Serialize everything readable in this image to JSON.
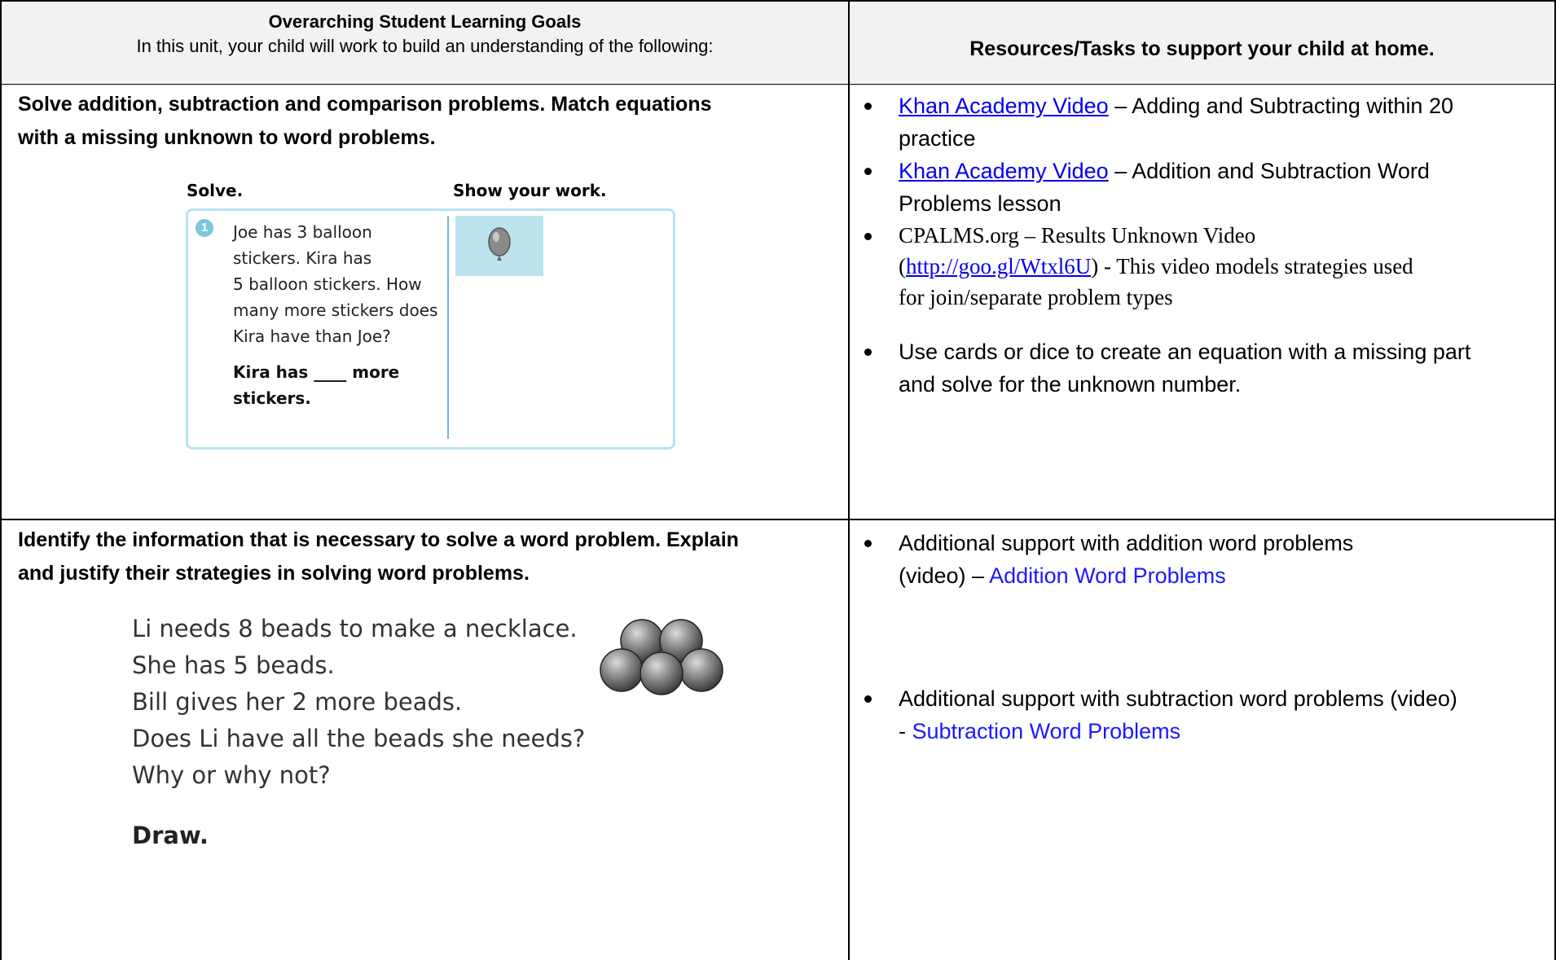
{
  "header": {
    "left_title": "Overarching Student Learning Goals",
    "left_subtitle": "In this unit, your child will work to build an understanding of the following:",
    "right_title": "Resources/Tasks to support your child at home."
  },
  "rows": [
    {
      "goal_line1": "Solve addition, subtraction and comparison problems. Match equations",
      "goal_line2": "with a missing unknown to word problems.",
      "worksheet": {
        "solve_label": "Solve.",
        "show_label": "Show your work.",
        "number": "1",
        "problem_lines": [
          "Joe has 3 balloon",
          "stickers. Kira has",
          "5 balloon stickers. How",
          "many more stickers does",
          "Kira have than Joe?"
        ],
        "answer_line1": "Kira has ____ more",
        "answer_line2": "stickers."
      },
      "resources": [
        {
          "link": "Khan Academy Video",
          "rest1": " – Adding and Subtracting within 20",
          "rest2": "practice"
        },
        {
          "link": "Khan Academy Video",
          "rest1": " – Addition and Subtraction Word",
          "rest2": "Problems lesson"
        },
        {
          "line1": "CPALMS.org – Results Unknown Video",
          "paren_open": "(",
          "url": "http://goo.gl/Wtxl6U",
          "line2_rest": ") - This video models strategies used",
          "line3": "for join/separate problem types"
        },
        {
          "line1": "Use cards or dice to create an equation with a missing part",
          "line2": "and solve for the unknown number."
        }
      ]
    },
    {
      "goal_line1": "Identify the information that is necessary to solve a word problem.  Explain",
      "goal_line2": "and justify their strategies in solving word problems.",
      "worksheet": {
        "lines": [
          "Li needs 8 beads to make a necklace.",
          "She has 5 beads.",
          "Bill gives her 2 more beads.",
          "Does Li have all the beads she needs?",
          "Why or why not?"
        ],
        "draw_label": "Draw."
      },
      "resources": [
        {
          "line1": "Additional support with addition word problems",
          "line2_prefix": "(video) – ",
          "link": "Addition Word Problems"
        },
        {
          "line1": "Additional support with subtraction word problems (video)",
          "line2_prefix": "- ",
          "link": "Subtraction Word Problems"
        }
      ]
    }
  ]
}
